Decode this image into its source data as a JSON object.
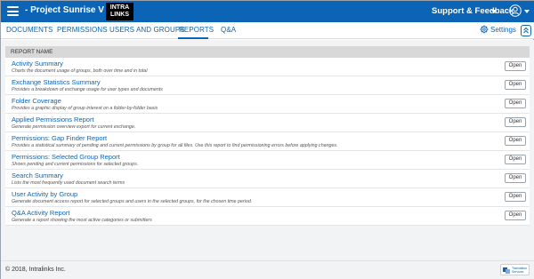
{
  "header": {
    "project_title": "- Project Sunrise V",
    "logo_line1": "INTRA",
    "logo_line2": "LINKS",
    "support_label": "Support & Feedback"
  },
  "nav": {
    "tabs": [
      {
        "label": "DOCUMENTS"
      },
      {
        "label": "PERMISSIONS"
      },
      {
        "label": "USERS AND GROUPS"
      },
      {
        "label": "REPORTS"
      },
      {
        "label": "Q&A"
      }
    ],
    "active_tab": "REPORTS",
    "settings_label": "Settings"
  },
  "reports": {
    "column_header": "REPORT NAME",
    "open_label": "Open",
    "rows": [
      {
        "title": "Activity Summary",
        "description": "Charts the document usage of groups, both over time and in total"
      },
      {
        "title": "Exchange Statistics Summary",
        "description": "Provides a breakdown of exchange usage for user types and documents"
      },
      {
        "title": "Folder Coverage",
        "description": "Provides a graphic display of group interest on a folder-by-folder basis"
      },
      {
        "title": "Applied Permissions Report",
        "description": "Generate permission overview export for current exchange."
      },
      {
        "title": "Permissions: Gap Finder Report",
        "description": "Provides a statistical summary of pending and current permissions by group for all files. Use this report to find permissioning errors before applying changes."
      },
      {
        "title": "Permissions: Selected Group Report",
        "description": "Shows pending and current permissions for selected groups."
      },
      {
        "title": "Search Summary",
        "description": "Lists the most frequently used document search terms"
      },
      {
        "title": "User Activity by Group",
        "description": "Generate document access report for selected groups and users in the selected groups, for the chosen time period."
      },
      {
        "title": "Q&A Activity Report",
        "description": "Generate a report showing the most active categories or submitters"
      }
    ]
  },
  "footer": {
    "copyright": "© 2018, Intralinks Inc.",
    "translate_line1": "Translation",
    "translate_line2": "Services"
  },
  "colors": {
    "brand_blue": "#0b64b6",
    "header_gray": "#d8d8d8",
    "background": "#f1f3f5"
  }
}
